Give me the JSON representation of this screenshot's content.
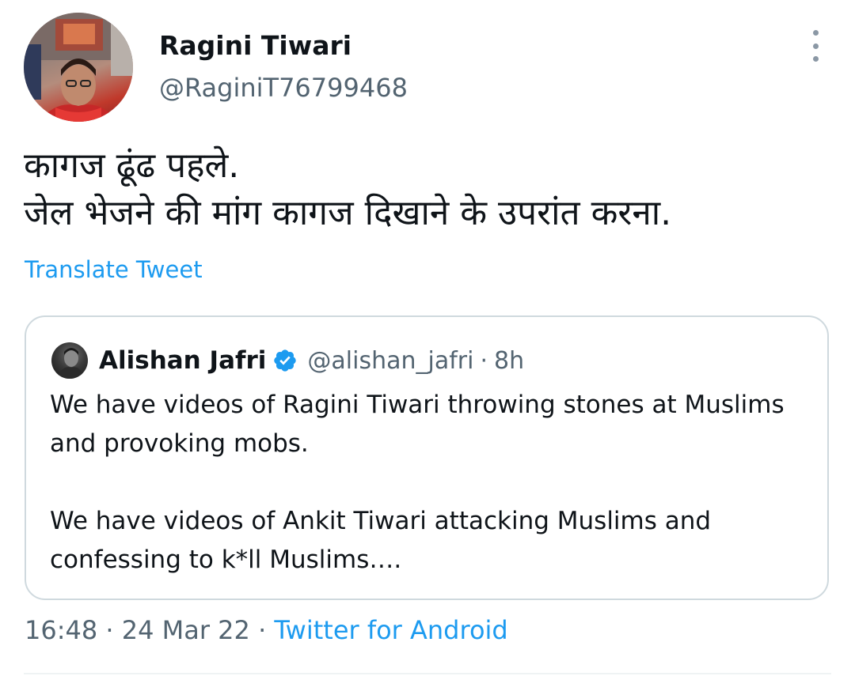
{
  "tweet": {
    "author": {
      "name": "Ragini Tiwari",
      "handle": "@RaginiT76799468"
    },
    "text_lines": [
      "कागज ढूंढ पहले.",
      "जेल भेजने की मांग  कागज दिखाने के उपरांत करना."
    ],
    "translate_label": "Translate Tweet",
    "time": "16:48",
    "separator": "·",
    "date": "24 Mar 22",
    "source": "Twitter for Android",
    "more_icon": "more-vertical-icon"
  },
  "quoted_tweet": {
    "author": {
      "name": "Alishan Jafri",
      "handle": "@alishan_jafri",
      "verified": true
    },
    "separator": "·",
    "time": "8h",
    "paragraphs": [
      "We have videos of Ragini Tiwari throwing stones at Muslims and provoking mobs.",
      "We have videos of Ankit Tiwari attacking Muslims and confessing to k*ll Muslims…."
    ]
  },
  "colors": {
    "link": "#1d9bf0",
    "secondary_text": "#536471",
    "primary_text": "#0f1419",
    "border": "#cfd9de"
  }
}
